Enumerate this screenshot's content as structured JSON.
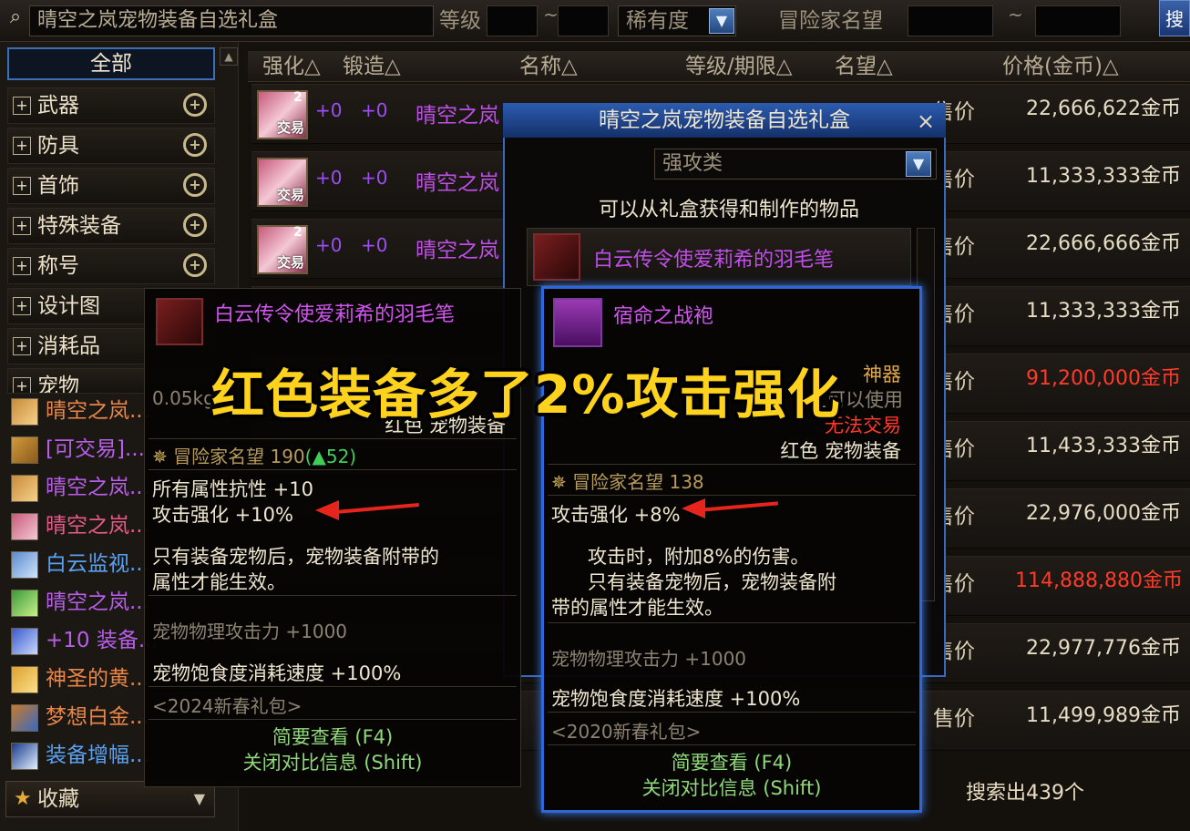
{
  "search": {
    "value": "晴空之岚宠物装备自选礼盒",
    "level_label": "等级",
    "tilde": "~",
    "rarity_label": "稀有度",
    "fame_label": "冒险家名望"
  },
  "categories": {
    "all": "全部",
    "items": [
      {
        "label": "武器"
      },
      {
        "label": "防具"
      },
      {
        "label": "首饰"
      },
      {
        "label": "特殊装备"
      },
      {
        "label": "称号"
      },
      {
        "label": "设计图"
      },
      {
        "label": "消耗品"
      },
      {
        "label": "宠物"
      }
    ],
    "plus": "+",
    "zoom": "+"
  },
  "item_list": [
    {
      "text": "晴空之岚...",
      "color": "#e8864a"
    },
    {
      "text": "[可交易]...",
      "color": "#b85ee8"
    },
    {
      "text": "晴空之岚...",
      "color": "#b85ee8"
    },
    {
      "text": "晴空之岚...",
      "color": "#e85a8a"
    },
    {
      "text": "白云监视...",
      "color": "#5aa0f0"
    },
    {
      "text": "晴空之岚...",
      "color": "#b85ee8"
    },
    {
      "text": "+10 装备...",
      "color": "#b85ee8"
    },
    {
      "text": "神圣的黄...",
      "color": "#e8864a"
    },
    {
      "text": "梦想白金...",
      "color": "#e8864a"
    },
    {
      "text": "装备增幅...",
      "color": "#5aa0f0"
    }
  ],
  "favorites": {
    "label": "收藏",
    "star": "★",
    "arrow": "▼"
  },
  "table": {
    "headers": {
      "enhance": "强化△",
      "forge": "锻造△",
      "name": "名称△",
      "level": "等级/期限△",
      "fame": "名望△",
      "price": "价格(金币)△"
    },
    "rows": [
      {
        "enhance": "+0",
        "forge": "+0",
        "name": "晴空之岚",
        "badge": "2",
        "trade": "交易",
        "price_label": "售价",
        "price": "22,666,622",
        "unit": "金币",
        "red": false
      },
      {
        "enhance": "+0",
        "forge": "+0",
        "name": "晴空之岚",
        "badge": "",
        "trade": "交易",
        "price_label": "售价",
        "price": "11,333,333",
        "unit": "金币",
        "red": false
      },
      {
        "enhance": "+0",
        "forge": "+0",
        "name": "晴空之岚",
        "badge": "2",
        "trade": "交易",
        "price_label": "售价",
        "price": "22,666,666",
        "unit": "金币",
        "red": false
      },
      {
        "price_label": "售价",
        "price": "11,333,333",
        "unit": "金币",
        "red": false
      },
      {
        "price_label": "售价",
        "price": "91,200,000",
        "unit": "金币",
        "red": true
      },
      {
        "price_label": "售价",
        "price": "11,433,333",
        "unit": "金币",
        "red": false
      },
      {
        "price_label": "售价",
        "price": "22,976,000",
        "unit": "金币",
        "red": false
      },
      {
        "price_label": "售价",
        "price": "114,888,880",
        "unit": "金币",
        "red": true
      },
      {
        "price_label": "售价",
        "price": "22,977,776",
        "unit": "金币",
        "red": false
      },
      {
        "price_label": "售价",
        "price": "11,499,989",
        "unit": "金币",
        "red": false
      }
    ],
    "result_count": "搜索出439个"
  },
  "gift_popup": {
    "title": "晴空之岚宠物装备自选礼盒",
    "close": "×",
    "select_value": "强攻类",
    "subtitle": "可以从礼盒获得和制作的物品",
    "item_name": "白云传令使爱莉希的羽毛笔"
  },
  "tooltip_left": {
    "name": "白云传令使爱莉希的羽毛笔",
    "weight": "0.05kg",
    "type": "红色 宠物装备",
    "fame_label": "冒险家名望",
    "fame_value": "190",
    "fame_diff": "(▲52)",
    "stat1": "所有属性抗性 +10",
    "stat2": "攻击强化 +10%",
    "desc1": "只有装备宠物后，宠物装备附带的",
    "desc2": "属性才能生效。",
    "pet_atk": "宠物物理攻击力 +1000",
    "pet_food": "宠物饱食度消耗速度 +100%",
    "source": "<2024新春礼包>",
    "brief": "简要查看 (F4)",
    "close_compare": "关闭对比信息 (Shift)"
  },
  "tooltip_right": {
    "name": "宿命之战袍",
    "rarity": "神器",
    "usable": "上可以使用",
    "trade": "无法交易",
    "type": "红色 宠物装备",
    "fame_label": "冒险家名望",
    "fame_value": "138",
    "stat1": "攻击强化 +8%",
    "desc1": "攻击时，附加8%的伤害。",
    "desc2": "只有装备宠物后，宠物装备附",
    "desc3": "带的属性才能生效。",
    "pet_atk": "宠物物理攻击力 +1000",
    "pet_food": "宠物饱食度消耗速度 +100%",
    "source": "<2020新春礼包>",
    "brief": "简要查看 (F4)",
    "close_compare": "关闭对比信息 (Shift)"
  },
  "caption": "红色装备多了2%攻击强化"
}
